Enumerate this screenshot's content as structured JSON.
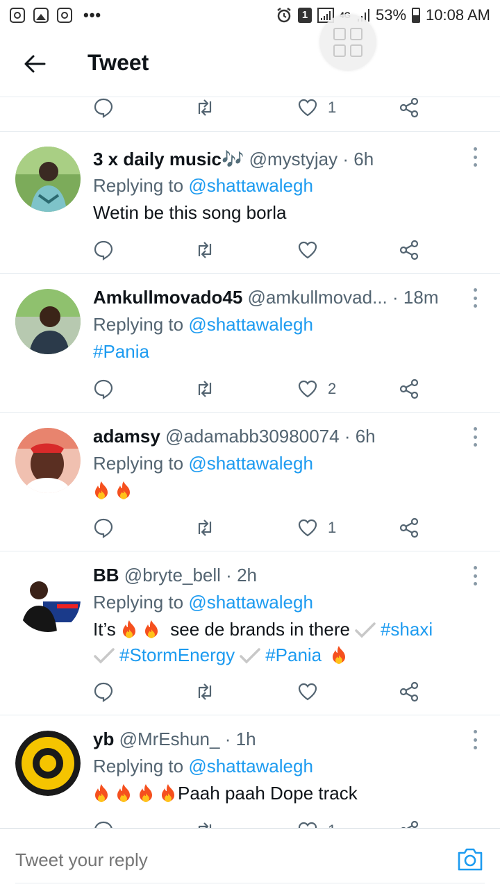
{
  "status_bar": {
    "left_icons": [
      "instagram-icon",
      "gallery-icon",
      "instagram-icon"
    ],
    "dots": "•••",
    "badge": "1",
    "network": "4G",
    "battery": "53%",
    "time": "10:08 AM"
  },
  "header": {
    "title": "Tweet"
  },
  "partial_top": {
    "like_count": "1"
  },
  "tweets": [
    {
      "name": "3 x daily music🎶",
      "handle": "@mystyjay",
      "time": "6h",
      "reply_prefix": "Replying to",
      "reply_to": "@shattawalegh",
      "text": "Wetin be this song borla",
      "like_count": ""
    },
    {
      "name": "Amkullmovado45",
      "handle": "@amkullmovad...",
      "time": "18m",
      "reply_prefix": "Replying to",
      "reply_to": "@shattawalegh",
      "text": "#Pania",
      "like_count": "2"
    },
    {
      "name": "adamsy",
      "handle": "@adamabb30980074",
      "time": "6h",
      "reply_prefix": "Replying to",
      "reply_to": "@shattawalegh",
      "text": "",
      "like_count": "1"
    },
    {
      "name": "BB",
      "handle": "@bryte_bell",
      "time": "2h",
      "reply_prefix": "Replying to",
      "reply_to": "@shattawalegh",
      "text_parts": {
        "start": "It’s",
        "middle": "see de brands in there",
        "tag1": "#shaxi",
        "tag2": "#StormEnergy",
        "tag3": "#Pania"
      },
      "like_count": ""
    },
    {
      "name": "yb",
      "handle": "@MrEshun_",
      "time": "1h",
      "reply_prefix": "Replying to",
      "reply_to": "@shattawalegh",
      "text": "Paah paah Dope track",
      "like_count": "1"
    }
  ],
  "reply_bar": {
    "placeholder": "Tweet your reply"
  },
  "colors": {
    "accent": "#1d9bf0",
    "secondary_text": "#536471",
    "divider": "#e6ecf0"
  }
}
